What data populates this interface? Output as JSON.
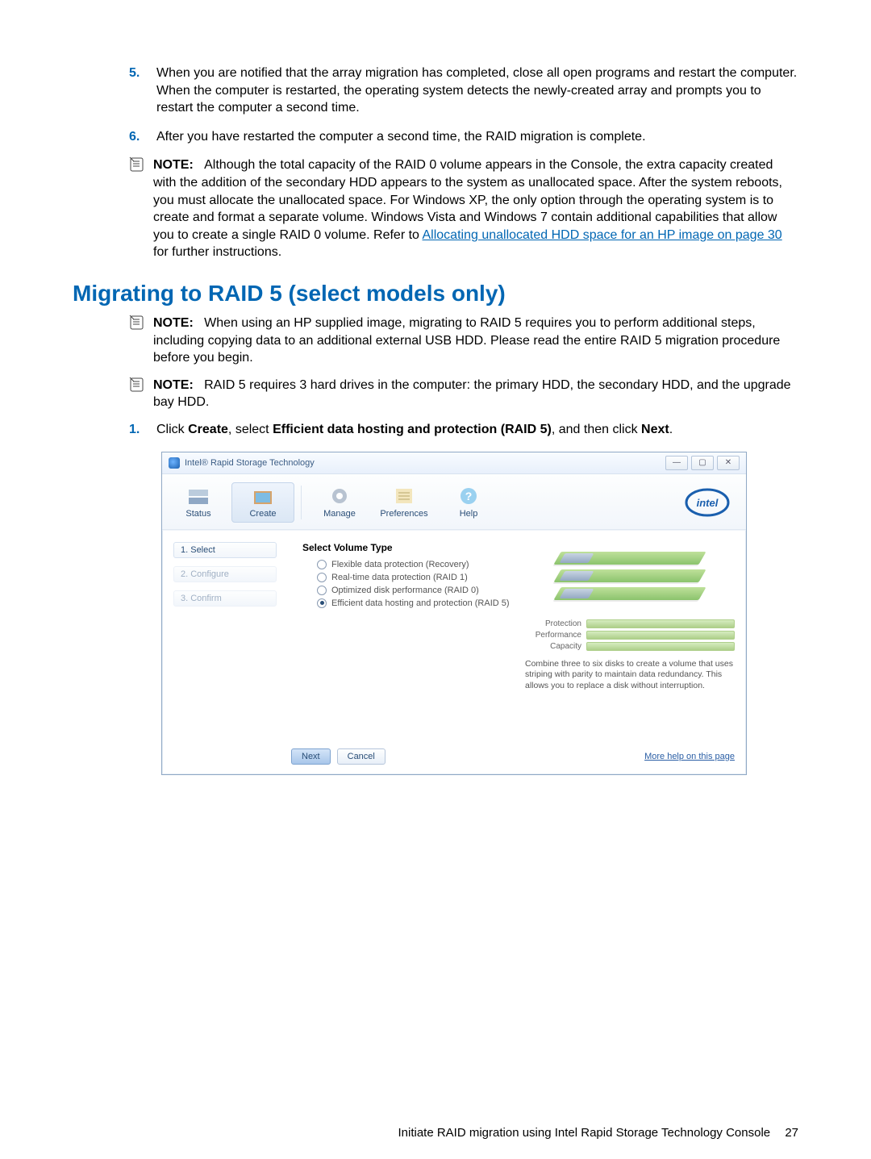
{
  "ol": {
    "item5_num": "5.",
    "item5_txt": "When you are notified that the array migration has completed, close all open programs and restart the computer. When the computer is restarted, the operating system detects the newly-created array and prompts you to restart the computer a second time.",
    "item6_num": "6.",
    "item6_txt": "After you have restarted the computer a second time, the RAID migration is complete."
  },
  "note1": {
    "label": "NOTE:",
    "text": "Although the total capacity of the RAID 0 volume appears in the Console, the extra capacity created with the addition of the secondary HDD appears to the system as unallocated space. After the system reboots, you must allocate the unallocated space. For Windows XP, the only option through the operating system is to create and format a separate volume. Windows Vista and Windows 7 contain additional capabilities that allow you to create a single RAID 0 volume. Refer to ",
    "link": "Allocating unallocated HDD space for an HP image on page 30",
    "tail": " for further instructions."
  },
  "section_title": "Migrating to RAID 5 (select models only)",
  "note2": {
    "label": "NOTE:",
    "text": "When using an HP supplied image, migrating to RAID 5 requires you to perform additional steps, including copying data to an additional external USB HDD. Please read the entire RAID 5 migration procedure before you begin."
  },
  "note3": {
    "label": "NOTE:",
    "text": "RAID 5 requires 3 hard drives in the computer: the primary HDD, the secondary HDD, and the upgrade bay HDD."
  },
  "step1": {
    "num": "1.",
    "pre": "Click ",
    "b1": "Create",
    "mid1": ", select ",
    "b2": "Efficient data hosting and protection (RAID 5)",
    "mid2": ", and then click ",
    "b3": "Next",
    "tail": "."
  },
  "win": {
    "title": "Intel® Rapid Storage Technology",
    "tb": {
      "status": "Status",
      "create": "Create",
      "manage": "Manage",
      "preferences": "Preferences",
      "help": "Help"
    },
    "intel": "intel",
    "steps": {
      "s1": "1. Select",
      "s2": "2. Configure",
      "s3": "3. Confirm"
    },
    "vol_title": "Select Volume Type",
    "radios": {
      "r1": "Flexible data protection (Recovery)",
      "r2": "Real-time data protection (RAID 1)",
      "r3": "Optimized disk performance (RAID 0)",
      "r4": "Efficient data hosting and protection (RAID 5)"
    },
    "bars": {
      "b1": "Protection",
      "b2": "Performance",
      "b3": "Capacity"
    },
    "desc": "Combine three to six disks to create a volume that uses striping with parity to maintain data redundancy. This allows you to replace a disk without interruption.",
    "btn_next": "Next",
    "btn_cancel": "Cancel",
    "more_help": "More help on this page"
  },
  "footer": {
    "text": "Initiate RAID migration using Intel Rapid Storage Technology Console",
    "page": "27"
  }
}
